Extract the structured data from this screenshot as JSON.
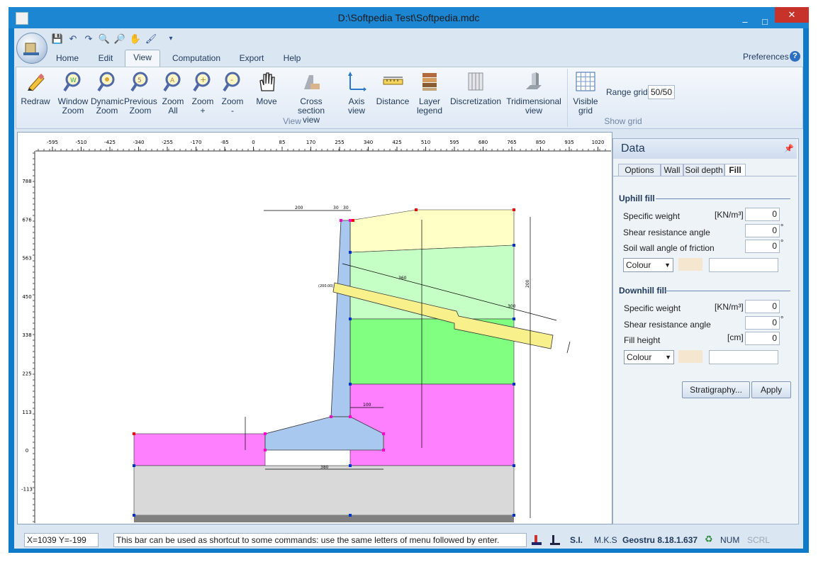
{
  "window": {
    "title": "D:\\Softpedia Test\\Softpedia.mdc"
  },
  "window_controls": {
    "minimize": "–",
    "maximize": "□",
    "close": "✕"
  },
  "quick_access": {
    "save": "💾",
    "undo": "↶",
    "redo": "↷",
    "zoom_in": "🔍",
    "zoom_out": "🔎",
    "pan": "✋",
    "paint": "🖌",
    "customize": "▾"
  },
  "menu_tabs": [
    {
      "label": "Home"
    },
    {
      "label": "Edit"
    },
    {
      "label": "View"
    },
    {
      "label": "Computation"
    },
    {
      "label": "Export"
    },
    {
      "label": "Help"
    }
  ],
  "preferences_label": "Preferences",
  "help_glyph": "?",
  "ribbon": {
    "buttons": [
      {
        "label1": "Redraw",
        "label2": "",
        "icon": "pencil-icon"
      },
      {
        "label1": "Window",
        "label2": "Zoom",
        "icon": "window-zoom-icon"
      },
      {
        "label1": "Dynamic",
        "label2": "Zoom",
        "icon": "dynamic-zoom-icon"
      },
      {
        "label1": "Previous",
        "label2": "Zoom",
        "icon": "previous-zoom-icon"
      },
      {
        "label1": "Zoom",
        "label2": "All",
        "icon": "zoom-all-icon"
      },
      {
        "label1": "Zoom",
        "label2": "+",
        "icon": "zoom-in-icon"
      },
      {
        "label1": "Zoom",
        "label2": "-",
        "icon": "zoom-out-icon"
      },
      {
        "label1": "Move",
        "label2": "",
        "icon": "hand-icon"
      },
      {
        "label1": "Cross section",
        "label2": "view",
        "icon": "cross-section-icon"
      },
      {
        "label1": "Axis",
        "label2": "view",
        "icon": "axis-icon"
      },
      {
        "label1": "Distance",
        "label2": "",
        "icon": "ruler-icon"
      },
      {
        "label1": "Layer",
        "label2": "legend",
        "icon": "layers-icon"
      },
      {
        "label1": "Discretization",
        "label2": "",
        "icon": "discretization-icon"
      },
      {
        "label1": "Tridimensional",
        "label2": "view",
        "icon": "3d-view-icon"
      },
      {
        "label1": "Visible",
        "label2": "grid",
        "icon": "grid-icon"
      }
    ],
    "group_view": "View",
    "group_grid": "Show grid",
    "range_grid_label": "Range grid",
    "range_grid_value": "50/50"
  },
  "ruler": {
    "top": [
      "-595",
      "-510",
      "-425",
      "-340",
      "-255",
      "-170",
      "-85",
      "0",
      "85",
      "170",
      "255",
      "340",
      "425",
      "510",
      "595",
      "680",
      "765",
      "850",
      "935",
      "1020"
    ],
    "left": [
      "788",
      "676",
      "563",
      "450",
      "338",
      "225",
      "113",
      "0",
      "-113"
    ]
  },
  "drawing": {
    "dim_200_top": "200",
    "dim_30_a": "30",
    "dim_30_b": "30",
    "dim_anchor": "(200.00)",
    "dim_360": "360",
    "dim_100": "100",
    "dim_380": "380",
    "dim_200_right": "200",
    "dim_300": "300"
  },
  "data_panel": {
    "title": "Data",
    "tabs": [
      {
        "label": "Options"
      },
      {
        "label": "Wall"
      },
      {
        "label": "Soil depth"
      },
      {
        "label": "Fill"
      }
    ],
    "uphill": {
      "title": "Uphill fill",
      "specific_weight_label": "Specific weight",
      "specific_weight_unit": "[KN/m³]",
      "specific_weight_value": "0",
      "shear_label": "Shear resistance angle",
      "shear_value": "0",
      "friction_label": "Soil wall angle of friction",
      "friction_value": "0",
      "colour_label": "Colour"
    },
    "downhill": {
      "title": "Downhill fill",
      "specific_weight_label": "Specific weight",
      "specific_weight_unit": "[KN/m³]",
      "specific_weight_value": "0",
      "shear_label": "Shear resistance angle",
      "shear_value": "0",
      "fill_height_label": "Fill height",
      "fill_height_unit": "[cm]",
      "fill_height_value": "0",
      "colour_label": "Colour"
    },
    "degree_symbol": "°",
    "stratigraphy_button": "Stratigraphy...",
    "apply_button": "Apply"
  },
  "status": {
    "coords": "X=1039  Y=-199",
    "hint": "This bar can be used as shortcut to some commands: use the same letters of menu followed by enter.",
    "units_si": "S.I.",
    "units_mks": "M.K.S",
    "version": "Geostru 8.18.1.637",
    "num": "NUM",
    "scrl": "SCRL"
  }
}
